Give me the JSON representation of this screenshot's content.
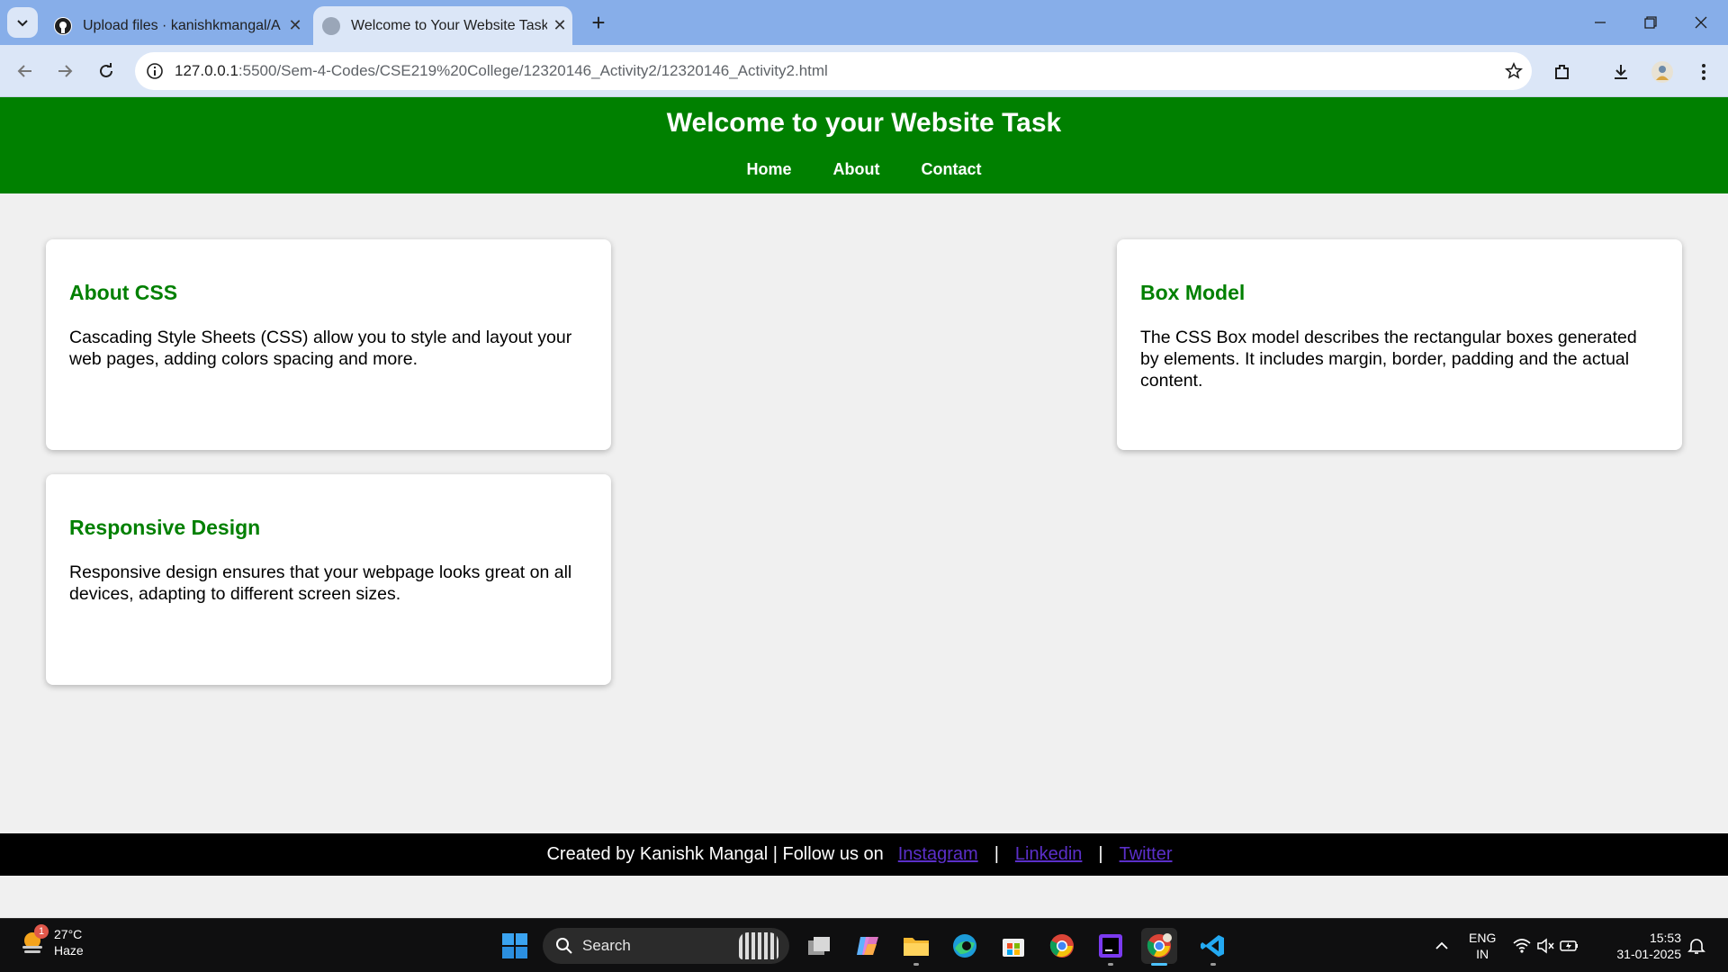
{
  "browser": {
    "tabs": [
      {
        "title": "Upload files · kanishkmangal/A",
        "active": false
      },
      {
        "title": "Welcome to Your Website Task",
        "active": true
      }
    ],
    "url_host": "127.0.0.1",
    "url_path": ":5500/Sem-4-Codes/CSE219%20College/12320146_Activity2/12320146_Activity2.html"
  },
  "site": {
    "title": "Welcome to your Website Task",
    "nav": [
      "Home",
      "About",
      "Contact"
    ],
    "cards": [
      {
        "heading": "About CSS",
        "text": "Cascading Style Sheets (CSS) allow you to style and layout your web pages, adding colors spacing and more."
      },
      {
        "heading": "Box Model",
        "text": "The CSS Box model describes the rectangular boxes generated by elements. It includes margin, border, padding and the actual content."
      },
      {
        "heading": "Responsive Design",
        "text": "Responsive design ensures that your webpage looks great on all devices, adapting to different screen sizes."
      }
    ],
    "footer": {
      "text": "Created by Kanishk Mangal | Follow us on",
      "links": [
        "Instagram",
        "Linkedin",
        "Twitter"
      ],
      "separator": "|"
    },
    "colors": {
      "header": "#008000",
      "heading": "#008000",
      "footer": "#000000",
      "link": "#5b2fc9"
    }
  },
  "taskbar": {
    "weather_temp": "27°C",
    "weather_desc": "Haze",
    "weather_badge": "1",
    "search_label": "Search",
    "lang_line1": "ENG",
    "lang_line2": "IN",
    "time": "15:53",
    "date": "31-01-2025"
  }
}
